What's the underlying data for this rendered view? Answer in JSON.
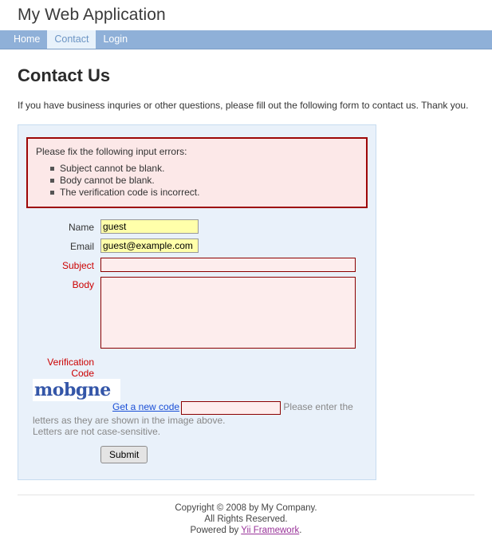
{
  "header": {
    "app_title": "My Web Application"
  },
  "nav": {
    "items": [
      {
        "label": "Home",
        "active": false
      },
      {
        "label": "Contact",
        "active": true
      },
      {
        "label": "Login",
        "active": false
      }
    ]
  },
  "page": {
    "title": "Contact Us",
    "intro": "If you have business inquries or other questions, please fill out the following form to contact us. Thank you."
  },
  "error_summary": {
    "heading": "Please fix the following input errors:",
    "errors": [
      "Subject cannot be blank.",
      "Body cannot be blank.",
      "The verification code is incorrect."
    ]
  },
  "form": {
    "name": {
      "label": "Name",
      "value": "guest",
      "placeholder": ""
    },
    "email": {
      "label": "Email",
      "value": "guest@example.com",
      "placeholder": ""
    },
    "subject": {
      "label": "Subject",
      "value": "",
      "placeholder": ""
    },
    "body": {
      "label": "Body",
      "value": "",
      "placeholder": ""
    },
    "verify": {
      "label_line1": "Verification",
      "label_line2": "Code",
      "captcha_text": "mobgne",
      "refresh_link": "Get a new code",
      "value": "",
      "placeholder": "",
      "hint_line1": "Please enter the letters as they are shown in the image above.",
      "hint_line2": "Letters are not case-sensitive."
    },
    "submit_label": "Submit"
  },
  "footer": {
    "copyright": "Copyright © 2008 by My Company.",
    "rights": "All Rights Reserved.",
    "powered_prefix": "Powered by ",
    "powered_link": "Yii Framework",
    "powered_suffix": "."
  },
  "colors": {
    "nav_bg": "#8fb0d8",
    "panel_bg": "#e9f1fa",
    "panel_border": "#c7dcf0",
    "error_border": "#9d0606",
    "error_bg": "#fce8e8",
    "error_label": "#cc0000",
    "autofill_bg": "#ffffaa",
    "field_error_bg": "#fdeded",
    "captcha_color": "#3456a8",
    "link_color": "#1a4fd6",
    "footer_link": "#993399"
  }
}
